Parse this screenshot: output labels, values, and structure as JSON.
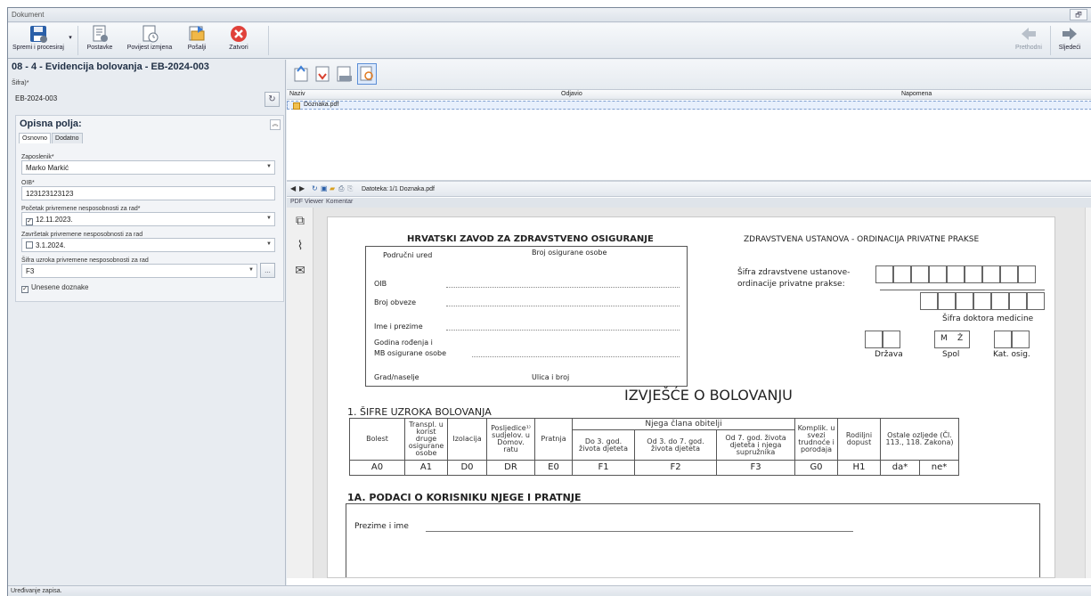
{
  "window": {
    "title": "Dokument",
    "restore_glyph": "🗗"
  },
  "ribbon": {
    "save_label": "Spremi i procesiraj",
    "settings_label": "Postavke",
    "history_label": "Povijest izmjena",
    "send_label": "Pošalji",
    "close_label": "Zatvori",
    "prev_label": "Prethodni",
    "next_label": "Sljedeći",
    "colors": {
      "save": "#2a5fa8",
      "close": "#e0413a",
      "arrows": "#7b8796"
    }
  },
  "form": {
    "title": "08 - 4 - Evidencija bolovanja - EB-2024-003",
    "code_label": "Šifra)*",
    "code_value": "EB-2024-003",
    "panel_title": "Opisna polja:",
    "tab_basic": "Osnovno",
    "tab_extra": "Dodatno",
    "employee_label": "Zaposlenik*",
    "employee_value": "Marko Markić",
    "oib_label": "OIB*",
    "oib_value": "123123123123",
    "start_label": "Početak privremene nesposobnosti za rad*",
    "start_value": "12.11.2023.",
    "start_checked": true,
    "end_label": "Završetak privremene nesposobnosti za rad",
    "end_value": "3.1.2024.",
    "end_checked": false,
    "cause_label": "Šifra uzroka privremene nesposobnosti za rad",
    "cause_value": "F3",
    "cause_button": "...",
    "entered_label": "Unesene doznake",
    "entered_checked": true
  },
  "attachments": {
    "columns": [
      "Naziv",
      "Odjavio",
      "Napomena"
    ],
    "rows": [
      {
        "name": "Doznaka.pdf"
      }
    ]
  },
  "viewer": {
    "file_label": "Datoteka:",
    "file_value": "1/1 Doznaka.pdf",
    "tab_pdf": "PDF Viewer",
    "tab_comment": "Komentar"
  },
  "pdf": {
    "hzzo_title": "HRVATSKI ZAVOD ZA ZDRAVSTVENO OSIGURANJE",
    "regional_office": "Područni ured",
    "insured_no": "Broj osigurane osobe",
    "oib": "OIB",
    "obligation_no": "Broj obveze",
    "name": "Ime i prezime",
    "birth_year": "Godina rođenja i",
    "mb": "MB osigurane osobe",
    "city": "Grad/naselje",
    "street": "Ulica i broj",
    "institution_title": "ZDRAVSTVENA USTANOVA - ORDINACIJA PRIVATNE PRAKSE",
    "institution_code_1": "Šifra zdravstvene ustanove-",
    "institution_code_2": "ordinacije privatne prakse:",
    "doctor_code": "Šifra doktora medicine",
    "m": "M",
    "z": "Ž",
    "country": "Država",
    "sex": "Spol",
    "insurance_cat": "Kat. osig.",
    "report_title": "IZVJEŠĆE O BOLOVANJU",
    "section1": "1. ŠIFRE UZROKA BOLOVANJA",
    "section1a": "1A. PODACI O KORISNIKU NJEGE I PRATNJE",
    "surname_name": "Prezime i ime",
    "table": {
      "bolest": "Bolest",
      "transpl": "Transpl. u korist druge osigurane osobe",
      "izolacija": "Izolacija",
      "posljedice": "Posljedice¹⁾ sudjelov. u Domov. ratu",
      "pratnja": "Pratnja",
      "njega": "Njega člana obitelji",
      "do3": "Do 3. god. života djeteta",
      "od3do7": "Od 3. do 7. god. života djeteta",
      "od7": "Od 7. god. života djeteta i njega supružnika",
      "komplik": "Komplik. u svezi trudnoće i porodaja",
      "rodiljni": "Rodiljni dopust",
      "ostale": "Ostale ozljede (Čl. 113., 118. Zakona)",
      "codes": [
        "A0",
        "A1",
        "D0",
        "DR",
        "E0",
        "F1",
        "F2",
        "F3",
        "G0",
        "H1",
        "da*",
        "ne*"
      ]
    }
  },
  "status": {
    "text": "Uređivanje zapisa."
  }
}
